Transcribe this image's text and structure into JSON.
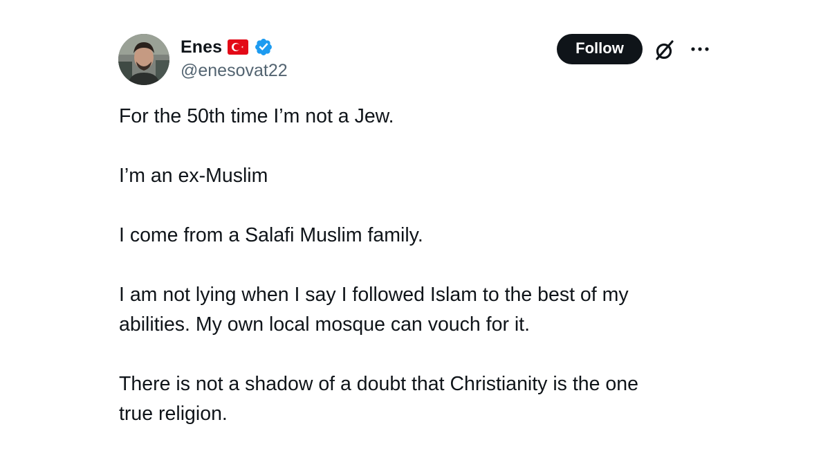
{
  "author": {
    "display_name": "Enes",
    "handle": "@enesovat22",
    "flag_icon": "turkey-flag-icon",
    "verified_icon": "verified-badge-icon",
    "verified_color": "#1d9bf0",
    "avatar": "profile-photo"
  },
  "actions": {
    "follow_label": "Follow",
    "grok_icon": "grok-icon",
    "more_icon": "more-options-icon"
  },
  "post": {
    "paragraphs": [
      "For the 50th time I’m not a Jew.",
      "I’m an ex-Muslim",
      "I come from a Salafi Muslim family.",
      "I am not lying when I say I followed Islam to the best of my\nabilities. My own local mosque can vouch for it.",
      "There is not a shadow of a doubt that Christianity is the one\ntrue religion."
    ]
  },
  "colors": {
    "text": "#0f1419",
    "secondary_text": "#536471",
    "follow_bg": "#0f1419",
    "follow_text": "#ffffff",
    "flag_red": "#e30a17"
  }
}
